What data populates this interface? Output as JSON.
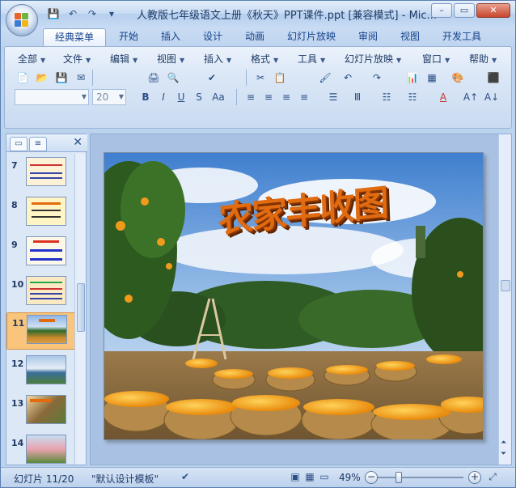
{
  "window": {
    "title": "人教版七年级语文上册《秋天》PPT课件.ppt [兼容模式] - Mic...",
    "controls": {
      "minimize": "–",
      "maximize": "▭",
      "close": "✕"
    }
  },
  "qat": {
    "save": "💾",
    "undo": "↶",
    "redo": "↷",
    "more": "▾"
  },
  "tabs": [
    "经典菜单",
    "开始",
    "插入",
    "设计",
    "动画",
    "幻灯片放映",
    "审阅",
    "视图",
    "开发工具"
  ],
  "menus": [
    "全部",
    "文件",
    "编辑",
    "视图",
    "插入",
    "格式",
    "工具",
    "幻灯片放映",
    "窗口",
    "帮助"
  ],
  "font": {
    "name": "",
    "size": "20"
  },
  "toolbar_icons": {
    "row1": [
      "📄",
      "📂",
      "💾",
      "✉",
      "🖨",
      "🔍",
      "✔",
      "✂",
      "📋",
      "🖌",
      "↶",
      "↷",
      "📊",
      "▦",
      "🎨",
      "⬛"
    ],
    "row2": [
      "B",
      "I",
      "U",
      "S",
      "Aa",
      "≡",
      "≡",
      "≡",
      "≡",
      "☰",
      "Ⅲ",
      "☷",
      "☷",
      "A",
      "A↑",
      "A↓"
    ]
  },
  "left_pane": {
    "close": "✕",
    "slides": [
      {
        "number": "7"
      },
      {
        "number": "8"
      },
      {
        "number": "9"
      },
      {
        "number": "10"
      },
      {
        "number": "11"
      },
      {
        "number": "12"
      },
      {
        "number": "13"
      },
      {
        "number": "14"
      }
    ],
    "selected": "11"
  },
  "slide": {
    "title": "农家丰收图"
  },
  "statusbar": {
    "slide_info": "幻灯片 11/20",
    "template": "\"默认设计模板\"",
    "zoom": "49%",
    "zoom_minus": "−",
    "zoom_plus": "+"
  },
  "colors": {
    "accent": "#15428b",
    "selected_thumb": "#f9c57c",
    "title_orange": "#e06b10"
  }
}
